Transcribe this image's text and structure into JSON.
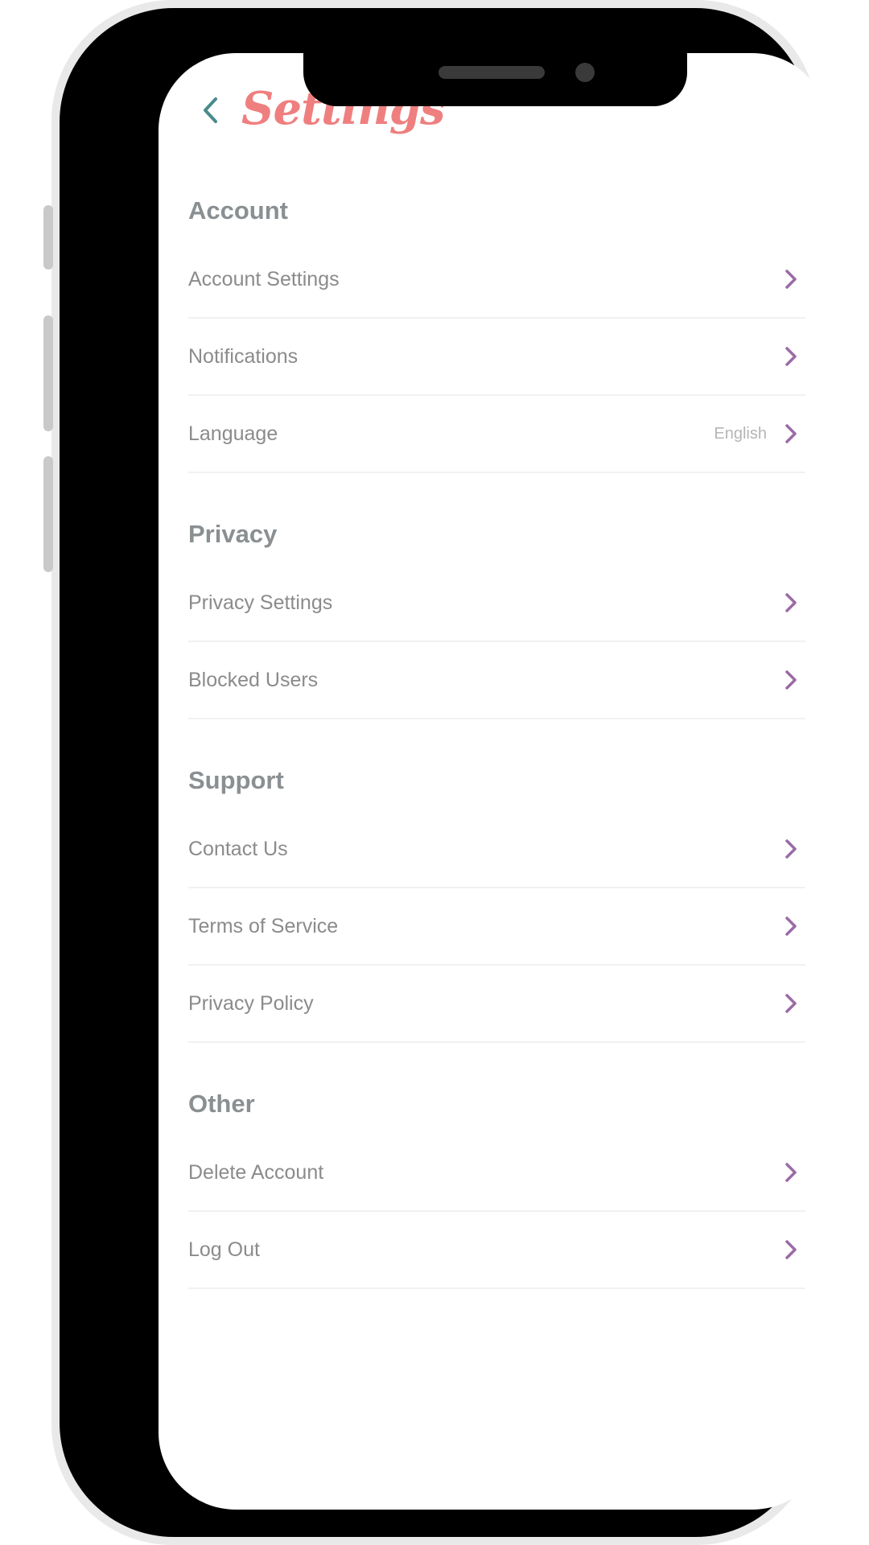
{
  "header": {
    "title": "Settings",
    "back_icon": "chevron-left-icon"
  },
  "colors": {
    "title": "#ef7f7f",
    "back_arrow": "#4a8a8c",
    "chevron": "#9b6aa6",
    "section_title": "#8a8f92",
    "row_label": "#8b8b8b",
    "divider": "#f1f1f1"
  },
  "sections": [
    {
      "title": "Account",
      "items": [
        {
          "label": "Account Settings",
          "value": ""
        },
        {
          "label": "Notifications",
          "value": ""
        },
        {
          "label": "Language",
          "value": "English"
        }
      ]
    },
    {
      "title": "Privacy",
      "items": [
        {
          "label": "Privacy Settings",
          "value": ""
        },
        {
          "label": "Blocked Users",
          "value": ""
        }
      ]
    },
    {
      "title": "Support",
      "items": [
        {
          "label": "Contact Us",
          "value": ""
        },
        {
          "label": "Terms of Service",
          "value": ""
        },
        {
          "label": "Privacy Policy",
          "value": ""
        }
      ]
    },
    {
      "title": "Other",
      "items": [
        {
          "label": "Delete Account",
          "value": ""
        },
        {
          "label": "Log Out",
          "value": ""
        }
      ]
    }
  ]
}
